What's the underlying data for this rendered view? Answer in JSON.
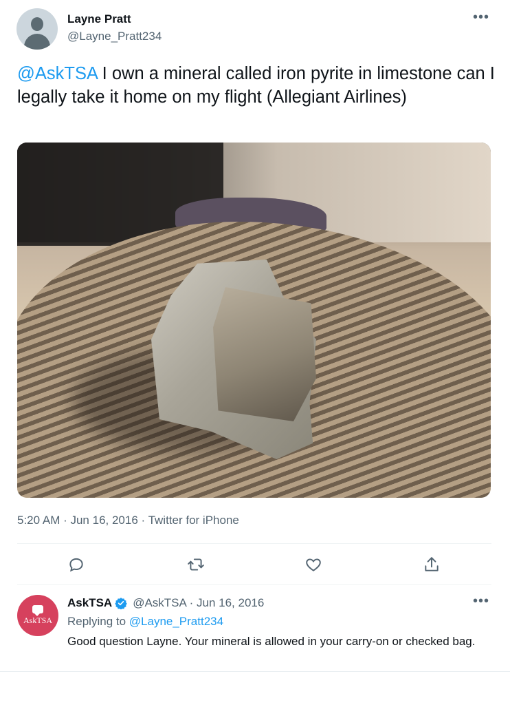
{
  "tweet": {
    "display_name": "Layne Pratt",
    "handle": "@Layne_Pratt234",
    "more_icon": "more-icon",
    "mention": "@AskTSA",
    "text": " I own a mineral called iron pyrite in limestone can I legally take it home on my flight (Allegiant Airlines)",
    "timestamp": "5:20 AM · Jun 16, 2016 · Twitter for iPhone",
    "actions": [
      "reply-icon",
      "retweet-icon",
      "like-icon",
      "share-icon"
    ]
  },
  "reply": {
    "avatar_text": "AskTSA",
    "display_name": "AskTSA",
    "handle_date": "@AskTSA · Jun 16, 2016",
    "replying_to_label": "Replying to ",
    "replying_to_mention": "@Layne_Pratt234",
    "text": "Good question Layne. Your mineral is allowed in your carry-on or checked bag."
  },
  "colors": {
    "accent": "#1d9bf0",
    "secondary_text": "#536471",
    "asktsa_avatar": "#d6415d"
  }
}
